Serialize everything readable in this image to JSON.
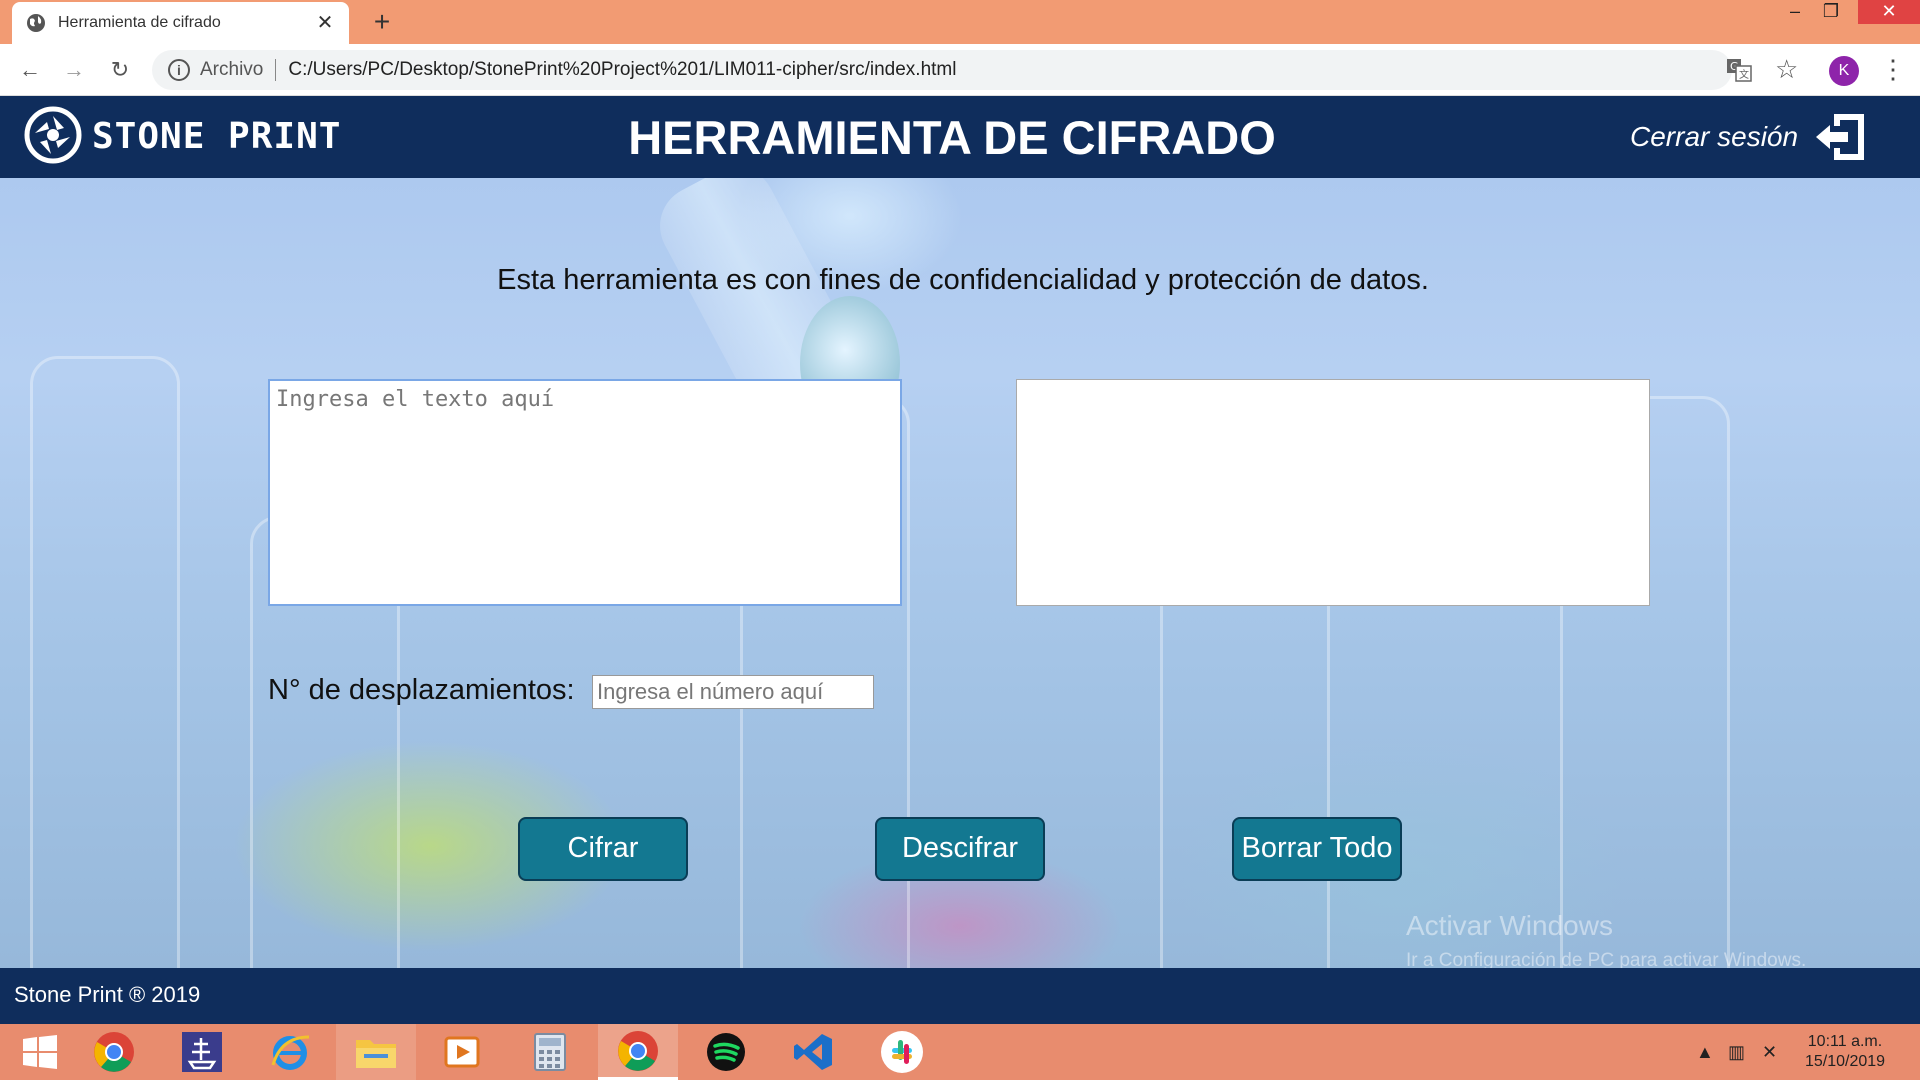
{
  "browser": {
    "tab_title": "Herramienta de cifrado",
    "url_scheme": "Archivo",
    "url": "C:/Users/PC/Desktop/StonePrint%20Project%201/LIM011-cipher/src/index.html",
    "profile_initial": "K"
  },
  "header": {
    "brand": "STONE PRINT",
    "title": "HERRAMIENTA DE CIFRADO",
    "logout_label": "Cerrar sesión"
  },
  "main": {
    "intro": "Esta herramienta es con fines de confidencialidad y protección de datos.",
    "input_placeholder": "Ingresa el texto aquí",
    "input_value": "",
    "output_value": "",
    "shift_label": "N° de desplazamientos:",
    "shift_placeholder": "Ingresa el número aquí",
    "shift_value": "",
    "buttons": {
      "encrypt": "Cifrar",
      "decrypt": "Descifrar",
      "clear": "Borrar Todo"
    }
  },
  "watermark": {
    "title": "Activar Windows",
    "subtitle": "Ir a Configuración de PC para activar Windows."
  },
  "footer": {
    "text": "Stone Print ® 2019"
  },
  "taskbar": {
    "apps": [
      "windows-start",
      "chrome",
      "steam-like",
      "internet-explorer",
      "file-explorer",
      "media-player",
      "calculator",
      "chrome-active",
      "spotify",
      "vscode",
      "slack"
    ],
    "clock_time": "10:11 a.m.",
    "clock_date": "15/10/2019"
  },
  "colors": {
    "header_bg": "#0f2d5c",
    "button_bg": "#137891",
    "tabstrip_bg": "#f29b73",
    "taskbar_bg": "#e88c6e"
  }
}
